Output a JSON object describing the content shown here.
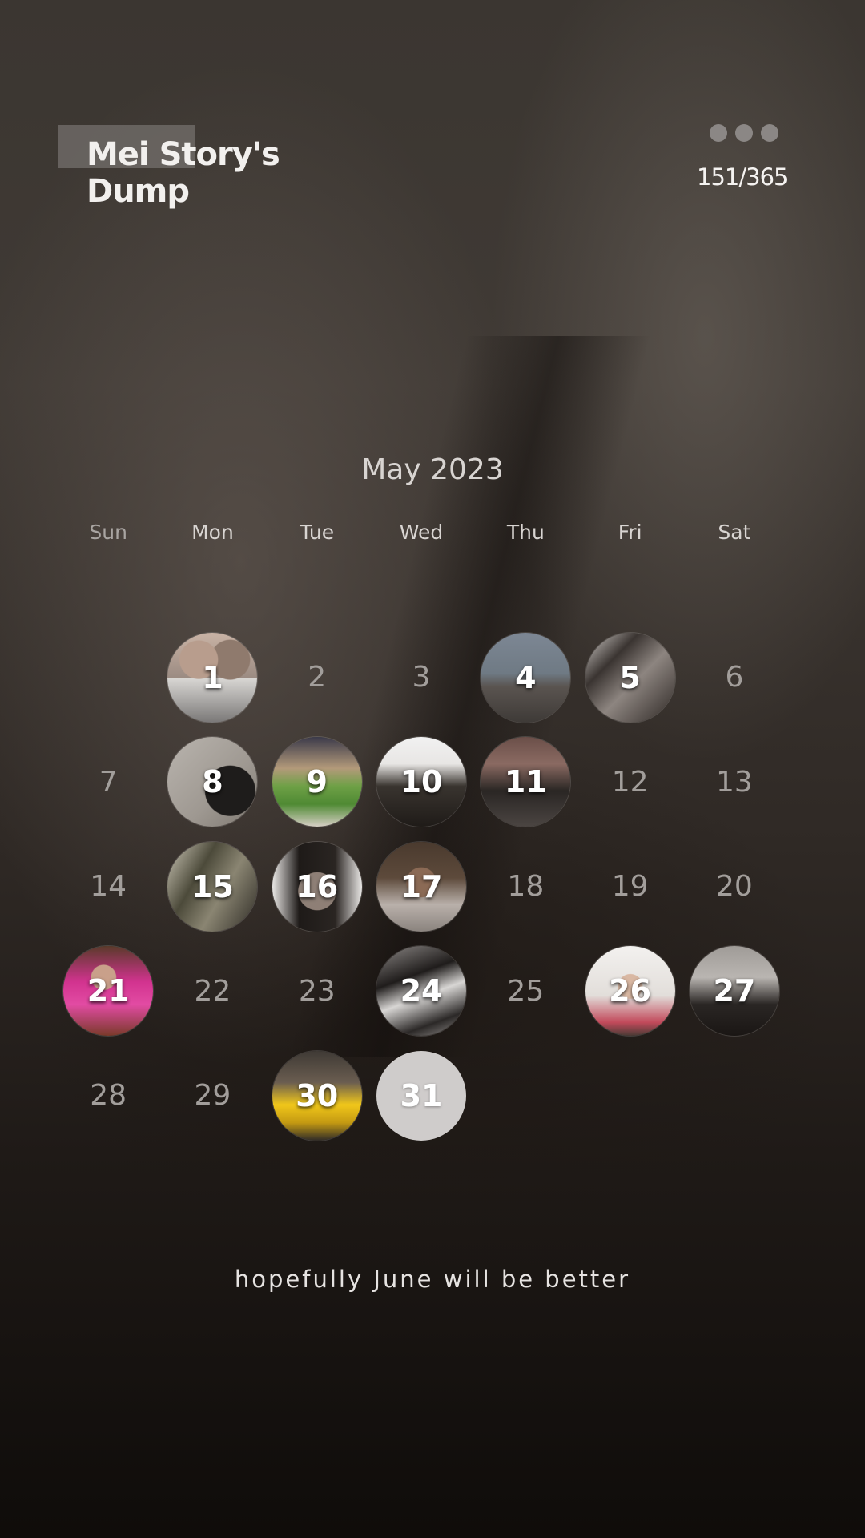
{
  "header": {
    "title_line1": "Mei Story's",
    "title_line2": "Dump",
    "counter": "151/365",
    "menu_icon": "more-dots-icon"
  },
  "calendar": {
    "month_label": "May 2023",
    "weekdays": [
      "Sun",
      "Mon",
      "Tue",
      "Wed",
      "Thu",
      "Fri",
      "Sat"
    ],
    "first_weekday_offset": 1,
    "days": [
      {
        "n": "1",
        "photo": true
      },
      {
        "n": "2",
        "photo": false
      },
      {
        "n": "3",
        "photo": false
      },
      {
        "n": "4",
        "photo": true
      },
      {
        "n": "5",
        "photo": true
      },
      {
        "n": "6",
        "photo": false
      },
      {
        "n": "7",
        "photo": false
      },
      {
        "n": "8",
        "photo": true
      },
      {
        "n": "9",
        "photo": true
      },
      {
        "n": "10",
        "photo": true
      },
      {
        "n": "11",
        "photo": true
      },
      {
        "n": "12",
        "photo": false
      },
      {
        "n": "13",
        "photo": false
      },
      {
        "n": "14",
        "photo": false
      },
      {
        "n": "15",
        "photo": true
      },
      {
        "n": "16",
        "photo": true
      },
      {
        "n": "17",
        "photo": true
      },
      {
        "n": "18",
        "photo": false
      },
      {
        "n": "19",
        "photo": false
      },
      {
        "n": "20",
        "photo": false
      },
      {
        "n": "21",
        "photo": true
      },
      {
        "n": "22",
        "photo": false
      },
      {
        "n": "23",
        "photo": false
      },
      {
        "n": "24",
        "photo": true
      },
      {
        "n": "25",
        "photo": false
      },
      {
        "n": "26",
        "photo": true
      },
      {
        "n": "27",
        "photo": true
      },
      {
        "n": "28",
        "photo": false
      },
      {
        "n": "29",
        "photo": false
      },
      {
        "n": "30",
        "photo": true
      },
      {
        "n": "31",
        "photo": false,
        "today": true
      }
    ]
  },
  "caption": "hopefully June will be better"
}
